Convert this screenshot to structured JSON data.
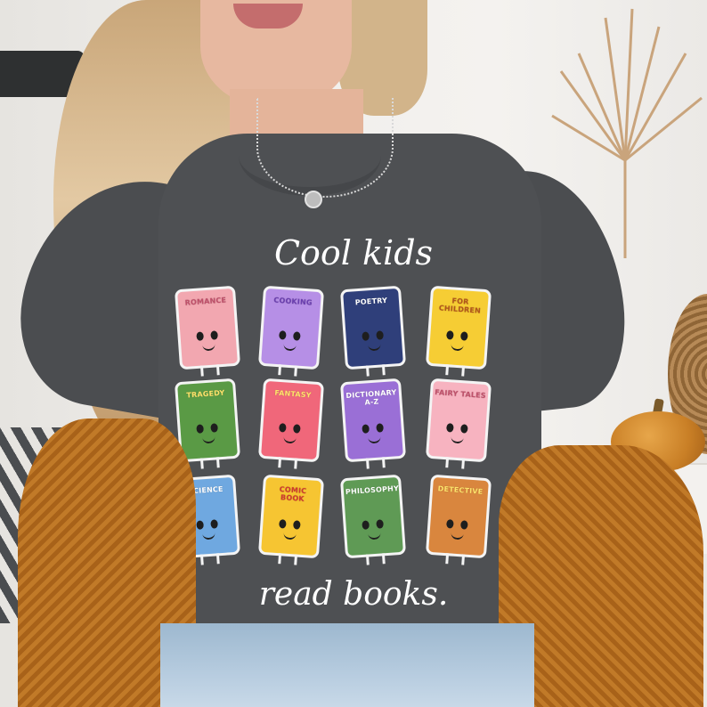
{
  "print": {
    "headline_top": "Cool kids",
    "headline_bottom": "read books."
  },
  "books": [
    {
      "label": "ROMANCE",
      "color": "#f2a7b0",
      "text_color": "#c0506a"
    },
    {
      "label": "COOKING",
      "color": "#b68fe6",
      "text_color": "#6b3fb0"
    },
    {
      "label": "POETRY",
      "color": "#2f3f7a",
      "text_color": "#ffffff"
    },
    {
      "label": "FOR CHILDREN",
      "color": "#f6cd34",
      "text_color": "#b3561b"
    },
    {
      "label": "TRAGEDY",
      "color": "#5a9a45",
      "text_color": "#ffe36b"
    },
    {
      "label": "FANTASY",
      "color": "#f0677a",
      "text_color": "#ffe36b"
    },
    {
      "label": "DICTIONARY A-Z",
      "color": "#9a6fd6",
      "text_color": "#ffffff"
    },
    {
      "label": "FAIRY TALES",
      "color": "#f7b3c0",
      "text_color": "#c0506a"
    },
    {
      "label": "SCIENCE",
      "color": "#6fa8e0",
      "text_color": "#ffffff"
    },
    {
      "label": "COMIC BOOK",
      "color": "#f6c532",
      "text_color": "#d0392f"
    },
    {
      "label": "PHILOSOPHY",
      "color": "#5f9a55",
      "text_color": "#ffffff"
    },
    {
      "label": "DETECTIVE",
      "color": "#d9863e",
      "text_color": "#ffe36b"
    }
  ]
}
